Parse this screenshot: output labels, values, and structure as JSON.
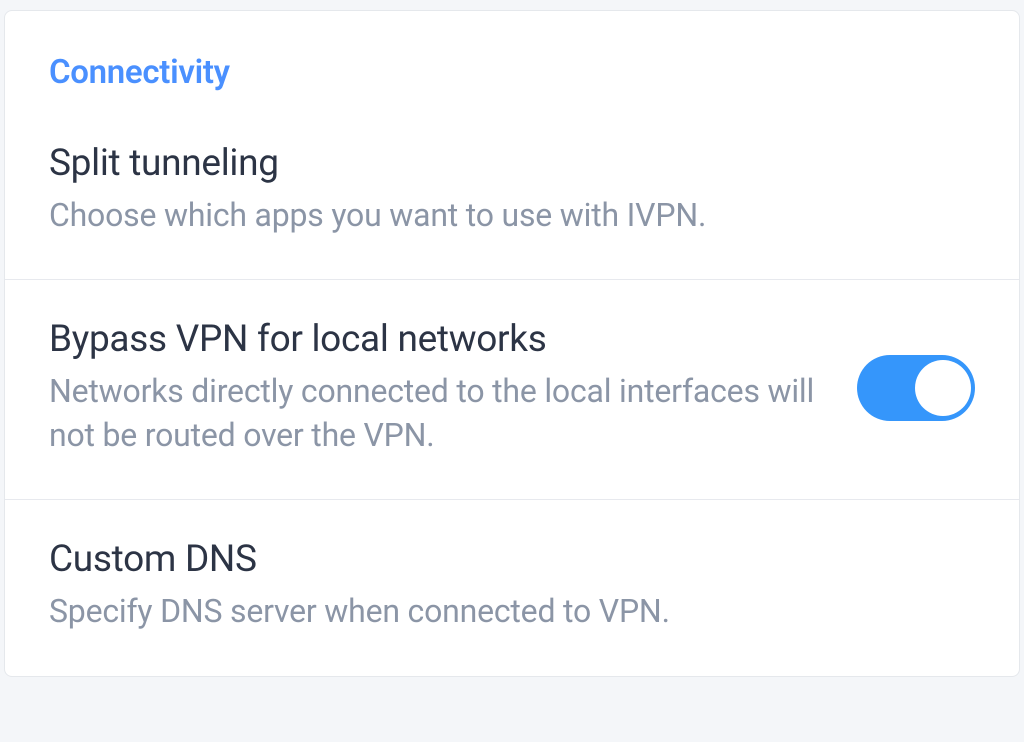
{
  "section": {
    "title": "Connectivity"
  },
  "settings": {
    "splitTunneling": {
      "title": "Split tunneling",
      "desc": "Choose which apps you want to use with IVPN."
    },
    "bypassLocal": {
      "title": "Bypass VPN for local networks",
      "desc": "Networks directly connected to the local interfaces will not be routed over the VPN.",
      "enabled": true
    },
    "customDns": {
      "title": "Custom DNS",
      "desc": "Specify DNS server when connected to VPN."
    }
  },
  "colors": {
    "accent": "#3596fb",
    "link": "#4a90ff"
  }
}
